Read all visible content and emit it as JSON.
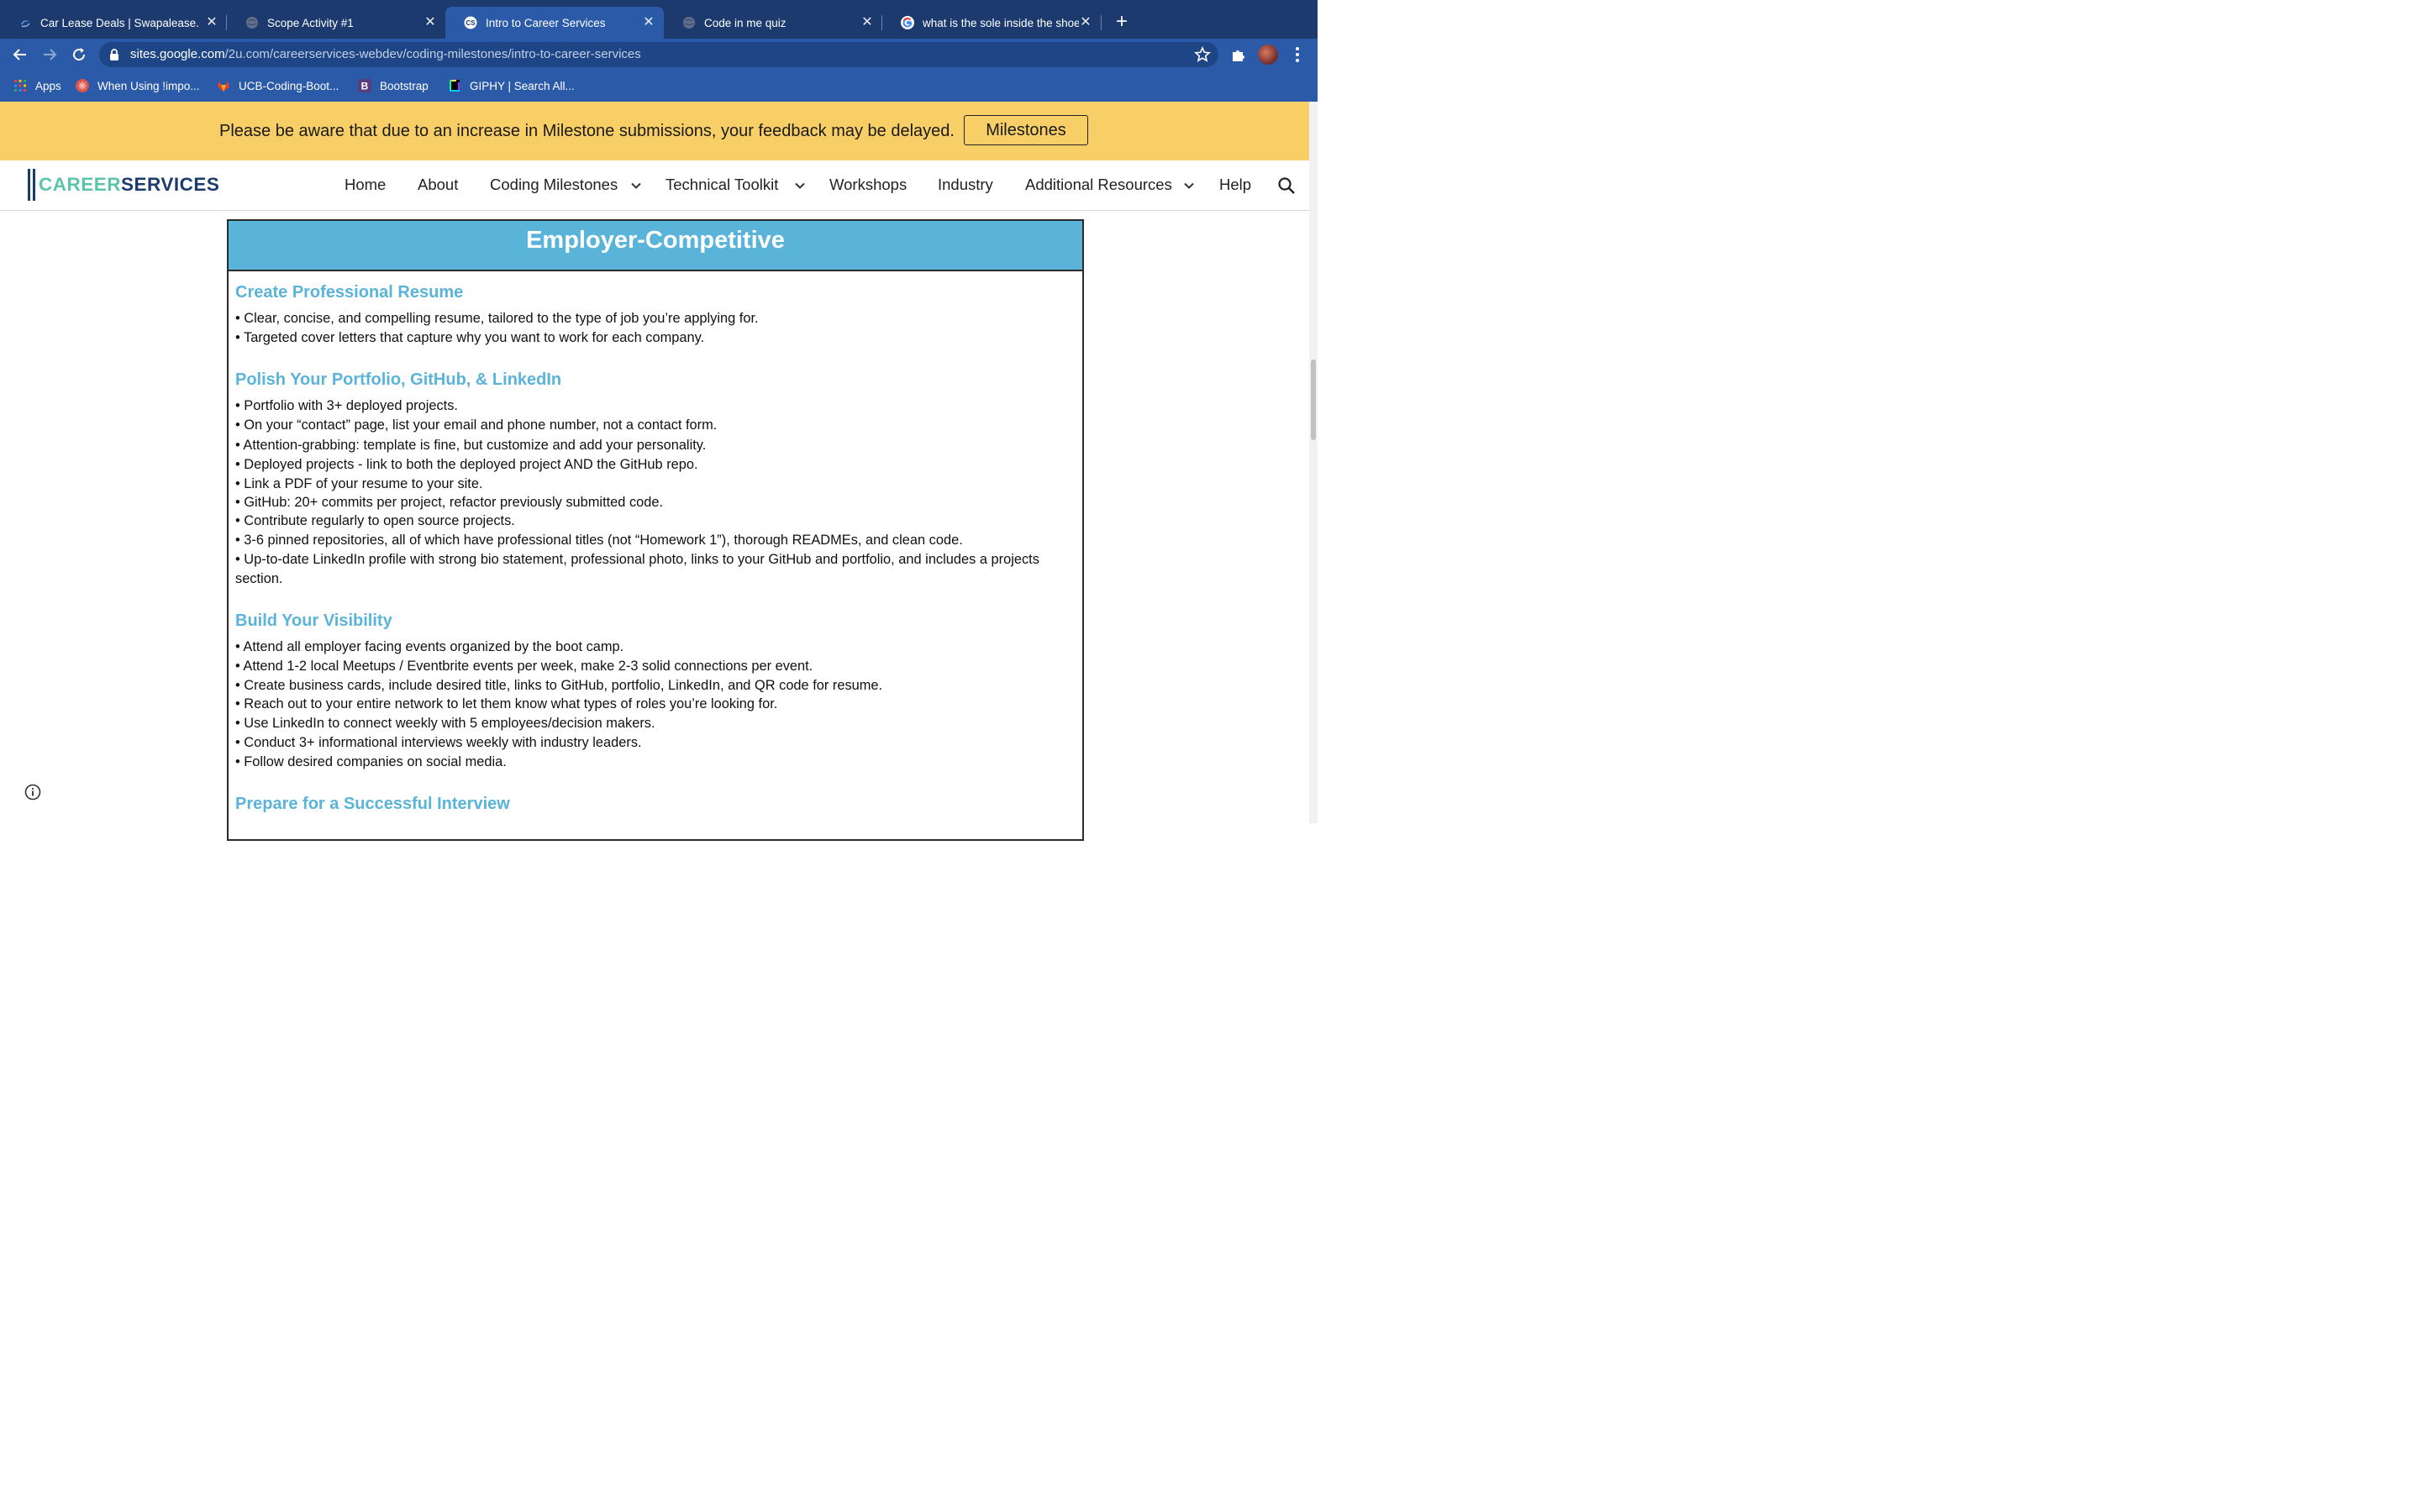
{
  "browser": {
    "tabs": [
      {
        "title": "Car Lease Deals | Swapalease.",
        "favicon": "swapalease-icon",
        "active": false
      },
      {
        "title": "Scope Activity #1",
        "favicon": "globe-icon",
        "active": false
      },
      {
        "title": "Intro to Career Services",
        "favicon": "cs-icon",
        "active": true
      },
      {
        "title": "Code in me quiz",
        "favicon": "globe-icon",
        "active": false
      },
      {
        "title": "what is the sole inside the shoe",
        "favicon": "google-icon",
        "active": false
      }
    ],
    "url_host": "sites.google.com",
    "url_path": "/2u.com/careerservices-webdev/coding-milestones/intro-to-career-services",
    "bookmarks": [
      {
        "label": "Apps",
        "icon": "apps-grid-icon"
      },
      {
        "label": "When Using !impo...",
        "icon": "red-circle-icon"
      },
      {
        "label": "UCB-Coding-Boot...",
        "icon": "gitlab-icon"
      },
      {
        "label": "Bootstrap",
        "icon": "bootstrap-icon"
      },
      {
        "label": "GIPHY | Search All...",
        "icon": "giphy-icon"
      }
    ]
  },
  "banner": {
    "message": "Please be aware that due to an increase in Milestone submissions, your feedback may be delayed.",
    "button_label": "Milestones"
  },
  "site": {
    "logo_part1": "CAREER",
    "logo_part2": "SERVICES",
    "nav": [
      "Home",
      "About",
      "Coding Milestones",
      "Technical Toolkit",
      "Workshops",
      "Industry",
      "Additional Resources",
      "Help"
    ]
  },
  "document": {
    "title": "Employer-Competitive",
    "sections": [
      {
        "title": "Create Professional Resume",
        "bullets": [
          "• Clear, concise, and compelling resume, tailored to the type of job you’re applying for.",
          "• Targeted cover letters that capture why you want to work for each company."
        ]
      },
      {
        "title": "Polish Your Portfolio, GitHub, & LinkedIn",
        "bullets": [
          "• Portfolio with 3+ deployed projects.",
          "• On your “contact” page, list your email and phone number, not a contact form.",
          "• Attention-grabbing: template is fine, but customize and add your personality.",
          "• Deployed projects - link to both the deployed project AND the GitHub repo.",
          "• Link a PDF of your resume to your site.",
          "• GitHub: 20+ commits per project, refactor previously submitted code.",
          "• Contribute regularly to open source projects.",
          "• 3-6 pinned repositories, all of which have professional titles (not “Homework 1”), thorough READMEs, and clean code.",
          "• Up-to-date LinkedIn profile with strong bio statement, professional photo, links to your GitHub and portfolio, and includes a projects section."
        ]
      },
      {
        "title": "Build Your Visibility",
        "bullets": [
          "• Attend all employer facing events organized by the boot camp.",
          "• Attend 1-2 local Meetups / Eventbrite events per week, make 2-3 solid connections per event.",
          "• Create business cards, include desired title, links to GitHub, portfolio, LinkedIn, and QR code for resume.",
          "• Reach out to your entire network to let them know what types of roles you’re looking for.",
          "• Use LinkedIn to connect weekly with 5 employees/decision makers.",
          "• Conduct 3+ informational interviews weekly with industry leaders.",
          "• Follow desired companies on social media."
        ]
      },
      {
        "title": "Prepare for a Successful Interview",
        "bullets": []
      }
    ]
  },
  "colors": {
    "tabstrip": "#1c3a6e",
    "toolbar": "#2b5ba8",
    "banner": "#f8cf66",
    "doc_accent": "#5ab4da",
    "logo_green": "#5ec4a8",
    "logo_navy": "#1a3b6e"
  }
}
